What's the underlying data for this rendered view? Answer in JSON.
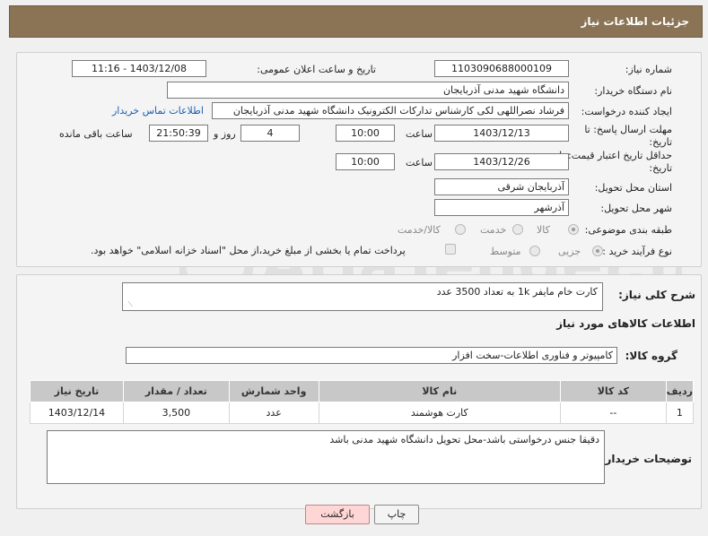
{
  "header": {
    "title": "جزئیات اطلاعات نیاز"
  },
  "form": {
    "need_number_label": "شماره نیاز:",
    "need_number": "1103090688000109",
    "announce_label": "تاریخ و ساعت اعلان عمومی:",
    "announce_value": "1403/12/08 - 11:16",
    "buyer_label": "نام دستگاه خریدار:",
    "buyer_value": "دانشگاه شهید مدنی آذربایجان",
    "creator_label": "ایجاد کننده درخواست:",
    "creator_value": "فرشاد نصراللهی لکی کارشناس تدارکات الکترونیک دانشگاه شهید مدنی آذربایجان",
    "contact_link": "اطلاعات تماس خریدار",
    "deadline_label_1": "مهلت ارسال پاسخ: تا",
    "deadline_label_2": "تاریخ:",
    "deadline_date": "1403/12/13",
    "time_label": "ساعت",
    "deadline_time": "10:00",
    "days_value": "4",
    "days_label": "روز و",
    "remaining_time": "21:50:39",
    "remaining_label": "ساعت باقی مانده",
    "validity_label_1": "حداقل تاریخ اعتبار قیمت: تا",
    "validity_label_2": "تاریخ:",
    "validity_date": "1403/12/26",
    "validity_time": "10:00",
    "province_label": "استان محل تحویل:",
    "province_value": "آذربایجان شرقی",
    "city_label": "شهر محل تحویل:",
    "city_value": "آذرشهر",
    "category_label": "طبقه بندی موضوعی:",
    "category_options": [
      "کالا",
      "خدمت",
      "کالا/خدمت"
    ],
    "process_label": "نوع فرآیند خرید :",
    "process_options": [
      "جزیی",
      "متوسط"
    ],
    "payment_note": "پرداخت تمام یا بخشی از مبلغ خرید،از محل \"اسناد خزانه اسلامی\" خواهد بود."
  },
  "details": {
    "summary_label": "شرح کلی نیاز:",
    "summary_value": "کارت خام مایفر 1k به تعداد 3500 عدد",
    "goods_info_title": "اطلاعات کالاهای مورد نیاز",
    "goods_group_label": "گروه کالا:",
    "goods_group_value": "کامپیوتر و فناوری اطلاعات-سخت افزار",
    "table": {
      "headers": [
        "ردیف",
        "کد کالا",
        "نام کالا",
        "واحد شمارش",
        "تعداد / مقدار",
        "تاریخ نیاز"
      ],
      "rows": [
        [
          "1",
          "--",
          "کارت هوشمند",
          "عدد",
          "3,500",
          "1403/12/14"
        ]
      ]
    },
    "buyer_notes_label": "توضیحات خریدار:",
    "buyer_notes_value": "دقیقا جنس درخواستی باشد-محل تحویل دانشگاه شهید مدنی باشد"
  },
  "buttons": {
    "print": "چاپ",
    "back": "بازگشت"
  },
  "watermark": {
    "text": "AriaTender.neT"
  }
}
